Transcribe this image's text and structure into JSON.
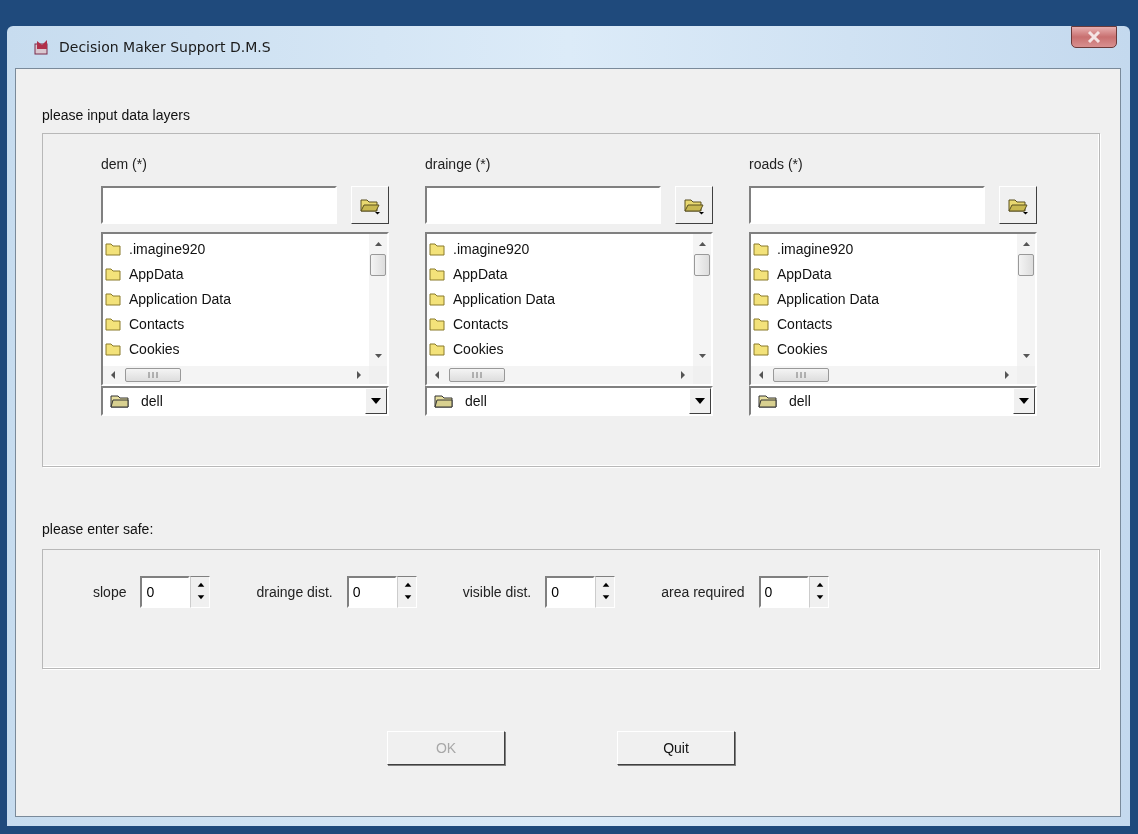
{
  "window": {
    "title": "Decision Maker Support D.M.S"
  },
  "layers_section": {
    "label": "please input data layers",
    "layers": [
      {
        "label": "dem (*)",
        "files": [
          ".imagine920",
          "AppData",
          "Application Data",
          "Contacts",
          "Cookies"
        ],
        "folder": "dell"
      },
      {
        "label": "drainge (*)",
        "files": [
          ".imagine920",
          "AppData",
          "Application Data",
          "Contacts",
          "Cookies"
        ],
        "folder": "dell"
      },
      {
        "label": "roads (*)",
        "files": [
          ".imagine920",
          "AppData",
          "Application Data",
          "Contacts",
          "Cookies"
        ],
        "folder": "dell"
      }
    ]
  },
  "safe_section": {
    "label": "please enter safe:",
    "fields": [
      {
        "label": "slope",
        "value": "0"
      },
      {
        "label": "drainge dist.",
        "value": "0"
      },
      {
        "label": "visible dist.",
        "value": "0"
      },
      {
        "label": "area required",
        "value": "0"
      }
    ]
  },
  "buttons": [
    {
      "label": "OK",
      "disabled": true
    },
    {
      "label": "Quit",
      "disabled": false
    }
  ]
}
